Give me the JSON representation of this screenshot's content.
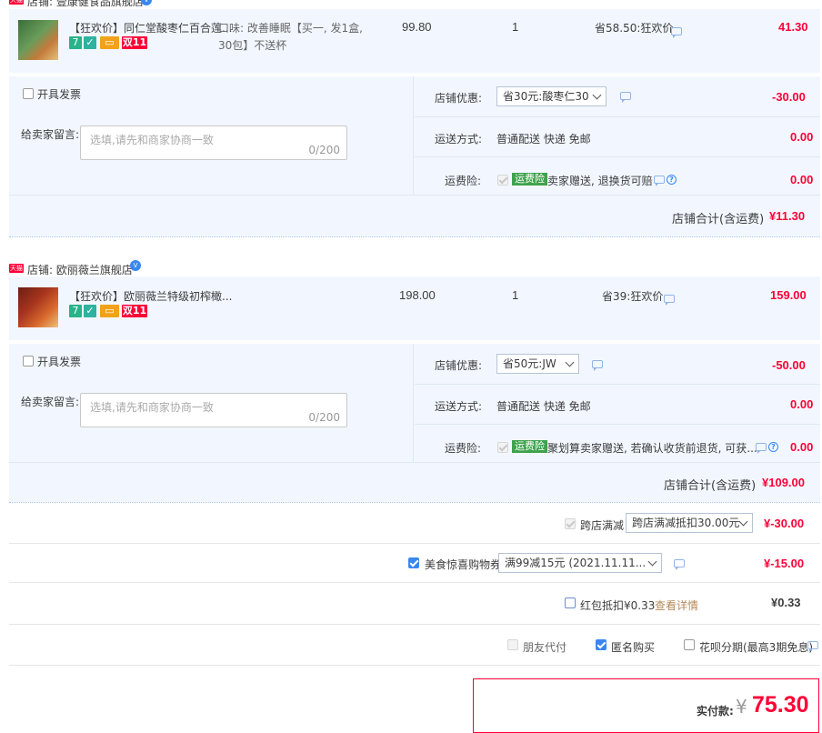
{
  "store1": {
    "name": "店铺: 壹康健食品旗舰店",
    "product": {
      "title": "【狂欢价】同仁堂酸枣仁百合莲...",
      "sku_line1": "口味: 改善睡眠【买一, 发1盒,",
      "sku_line2": "30包】不送杯",
      "price": "99.80",
      "qty": "1",
      "discount": "省58.50:狂欢价",
      "subtotal": "41.30",
      "badge_double11": "双11",
      "badge_7": "7"
    },
    "invoice_label": "开具发票",
    "memo_label": "给卖家留言:",
    "memo_placeholder": "选填,请先和商家协商一致",
    "memo_count": "0/200",
    "coupon_label": "店铺优惠:",
    "coupon_value": "省30元:酸枣仁30",
    "coupon_amount": "-30.00",
    "shipping_label": "运送方式:",
    "shipping_value": "普通配送 快递 免邮",
    "shipping_amount": "0.00",
    "insurance_label": "运费险:",
    "insurance_badge": "运费险",
    "insurance_text": "卖家赠送, 退换货可赔",
    "insurance_amount": "0.00",
    "total_label": "店铺合计(含运费)",
    "total_value": "¥11.30"
  },
  "store2": {
    "name": "店铺: 欧丽薇兰旗舰店",
    "product": {
      "title": "【狂欢价】欧丽薇兰特级初榨橄...",
      "price": "198.00",
      "qty": "1",
      "discount": "省39:狂欢价",
      "subtotal": "159.00",
      "badge_double11": "双11",
      "badge_7": "7"
    },
    "invoice_label": "开具发票",
    "memo_label": "给卖家留言:",
    "memo_placeholder": "选填,请先和商家协商一致",
    "memo_count": "0/200",
    "coupon_label": "店铺优惠:",
    "coupon_value": "省50元:JW",
    "coupon_amount": "-50.00",
    "shipping_label": "运送方式:",
    "shipping_value": "普通配送 快递 免邮",
    "shipping_amount": "0.00",
    "insurance_label": "运费险:",
    "insurance_badge": "运费险",
    "insurance_text": "聚划算卖家赠送, 若确认收货前退货, 可获...",
    "insurance_amount": "0.00",
    "total_label": "店铺合计(含运费)",
    "total_value": "¥109.00"
  },
  "cross_store": {
    "label": "跨店满减",
    "select_value": "跨店满减抵扣30.00元",
    "amount": "¥-30.00"
  },
  "food_coupon": {
    "label": "美食惊喜购物券",
    "select_value": "满99减15元 (2021.11.11...",
    "amount": "¥-15.00"
  },
  "red_packet": {
    "label": "红包抵扣¥0.33",
    "detail_link": "查看详情",
    "amount": "¥0.33"
  },
  "options": {
    "friend_pay": "朋友代付",
    "anonymous": "匿名购买",
    "huabei": "花呗分期(最高3期免息)"
  },
  "summary": {
    "label": "实付款:",
    "currency": "¥",
    "amount": "75.30"
  },
  "store_icon_text": "天猫",
  "colors": {
    "accent_red": "#ff0036",
    "accent_blue": "#3a87f0",
    "panel_bg": "#f2f7ff",
    "insurance_green": "#3fa24c"
  }
}
